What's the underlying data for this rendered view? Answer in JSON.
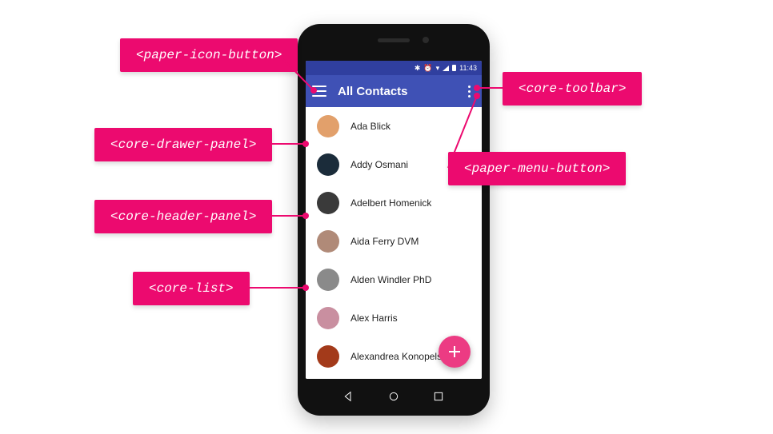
{
  "statusbar": {
    "time": "11:43",
    "bluetooth_icon": "✱"
  },
  "toolbar": {
    "title": "All Contacts"
  },
  "contacts": [
    {
      "name": "Ada Blick",
      "color": "#e2a06b"
    },
    {
      "name": "Addy Osmani",
      "color": "#1b2c3a"
    },
    {
      "name": "Adelbert Homenick",
      "color": "#3a3a3a"
    },
    {
      "name": "Aida Ferry DVM",
      "color": "#b08a78"
    },
    {
      "name": "Alden Windler PhD",
      "color": "#8a8a8a"
    },
    {
      "name": "Alex Harris",
      "color": "#c98fa0"
    },
    {
      "name": "Alexandrea Konopelski DVM",
      "color": "#a33a1a"
    }
  ],
  "callouts": {
    "paper_icon_button": "<paper-icon-button>",
    "core_toolbar": "<core-toolbar>",
    "core_drawer_panel": "<core-drawer-panel>",
    "paper_menu_button": "<paper-menu-button>",
    "core_header_panel": "<core-header-panel>",
    "core_list": "<core-list>"
  }
}
